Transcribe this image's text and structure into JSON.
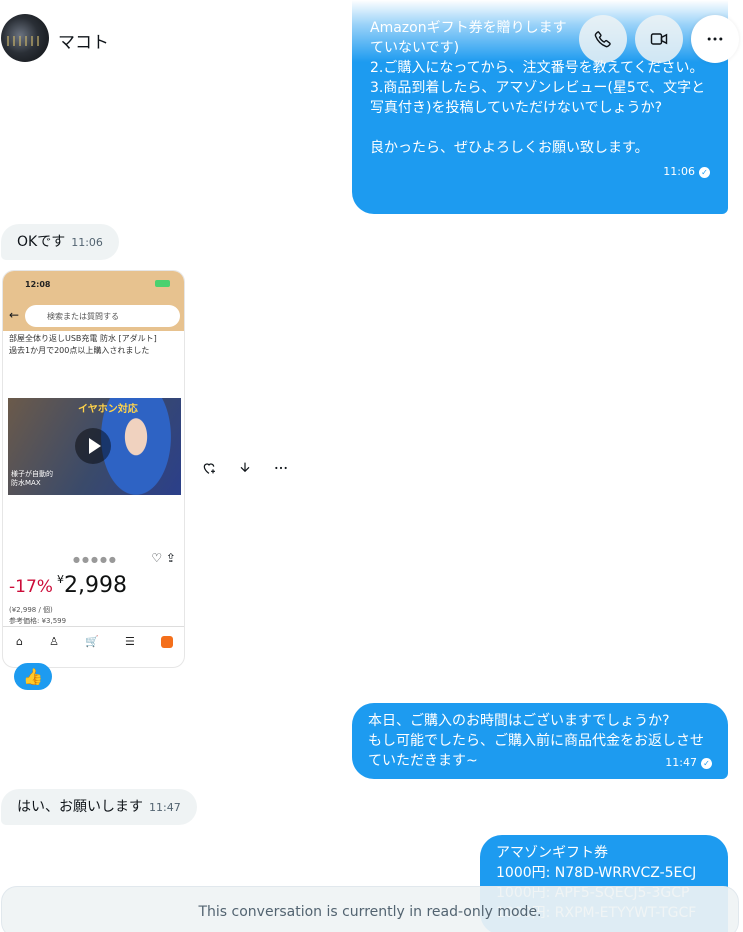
{
  "header": {
    "contact_name": "マコト",
    "call_label": "phone-icon",
    "video_label": "video-icon",
    "more_label": "more-icon"
  },
  "messages": [
    {
      "id": "m1",
      "direction": "outgoing",
      "text": "Amazonギフト券を贈りします\nていないです)\n2.ご購入になってから、注文番号を教えてください。\n3.商品到着したら、アマゾンレビュー(星5で、文字と写真付き)を投稿していただけないでしょうか?\n\n良かったら、ぜひよろしくお願い致します。",
      "time": "11:06"
    },
    {
      "id": "m2",
      "direction": "incoming",
      "text": "OKです",
      "time": "11:06"
    },
    {
      "id": "m3",
      "direction": "outgoing",
      "text": "本日、ご購入のお時間はございますでしょうか?\nもし可能でしたら、ご購入前に商品代金をお返しさせていただきます~",
      "time": "11:47"
    },
    {
      "id": "m4",
      "direction": "incoming",
      "text": "はい、お願いします",
      "time": "11:47"
    },
    {
      "id": "m5",
      "direction": "outgoing",
      "text": "アマゾンギフト券\n1000円: N78D-WRRVCZ-5ECJ\n1000円: APF5-SQECJ5-3GCP\n1000円: RXPM-ETYYWT-TGCF"
    }
  ],
  "screenshot_card": {
    "status_time": "12:08",
    "search_placeholder": "検索または質問する",
    "product_title": "部屋全体り返しUSB充電 防水 [アダルト]\n過去1か月で200点以上購入されました",
    "media_caption": "イヤホン対応",
    "media_tag": "様子が自動的\n防水MAX",
    "discount": "-17%",
    "price_symbol": "¥",
    "price": "2,998",
    "sub_price": "(¥2,998 / 個)\n参考価格: ¥3,599"
  },
  "reaction": {
    "emoji": "👍"
  },
  "footer": {
    "readonly_text": "This conversation is currently in read-only mode."
  },
  "colors": {
    "accent": "#1d9bf0",
    "incoming_bg": "#eff3f4",
    "text": "#0f1419"
  }
}
